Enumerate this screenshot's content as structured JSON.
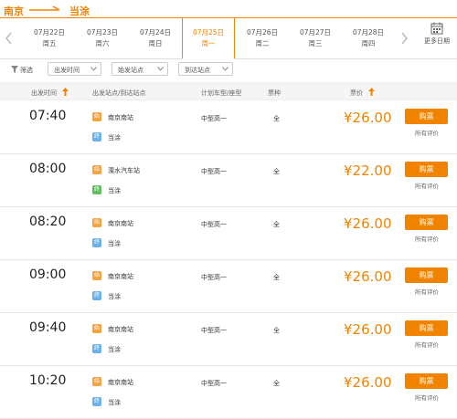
{
  "route": {
    "from": "南京",
    "to": "当涂"
  },
  "dates": [
    {
      "date": "07月22日",
      "weekday": "周五",
      "selected": false
    },
    {
      "date": "07月23日",
      "weekday": "周六",
      "selected": false
    },
    {
      "date": "07月24日",
      "weekday": "周日",
      "selected": false
    },
    {
      "date": "07月25日",
      "weekday": "周一",
      "selected": true
    },
    {
      "date": "07月26日",
      "weekday": "周二",
      "selected": false
    },
    {
      "date": "07月27日",
      "weekday": "周三",
      "selected": false
    },
    {
      "date": "07月28日",
      "weekday": "周四",
      "selected": false
    }
  ],
  "more_dates_label": "更多日期",
  "filters": {
    "label": "筛选",
    "depart_time": "出发时间",
    "depart_station": "始发站点",
    "arrive_station": "到达站点"
  },
  "table_headers": {
    "depart_time": "出发时间",
    "stations": "出发站点/到达站点",
    "bus_type": "计划车型/座型",
    "ticket_kind": "票种",
    "price": "票价"
  },
  "tag_labels": {
    "depart": "始",
    "arrive": "终"
  },
  "buy_label": "购票",
  "review_label": "所有评价",
  "rows": [
    {
      "time": "07:40",
      "from": "南京南站",
      "to": "当涂",
      "bus": "中型高一",
      "kind": "全",
      "price": "¥26.00"
    },
    {
      "time": "08:00",
      "from": "溧水汽车站",
      "to": "当涂",
      "bus": "中型高一",
      "kind": "全",
      "price": "¥22.00"
    },
    {
      "time": "08:20",
      "from": "南京南站",
      "to": "当涂",
      "bus": "中型高一",
      "kind": "全",
      "price": "¥26.00"
    },
    {
      "time": "09:00",
      "from": "南京南站",
      "to": "当涂",
      "bus": "中型高一",
      "kind": "全",
      "price": "¥26.00"
    },
    {
      "time": "09:40",
      "from": "南京南站",
      "to": "当涂",
      "bus": "中型高一",
      "kind": "全",
      "price": "¥26.00"
    },
    {
      "time": "10:20",
      "from": "南京南站",
      "to": "当涂",
      "bus": "中型高一",
      "kind": "全",
      "price": "¥26.00"
    }
  ],
  "colors": {
    "accent": "#f08300",
    "arrive_tag": "#6ab0ea",
    "arrive_tag_alt": "#5fbf5f",
    "depart_tag": "#f7a23b"
  }
}
